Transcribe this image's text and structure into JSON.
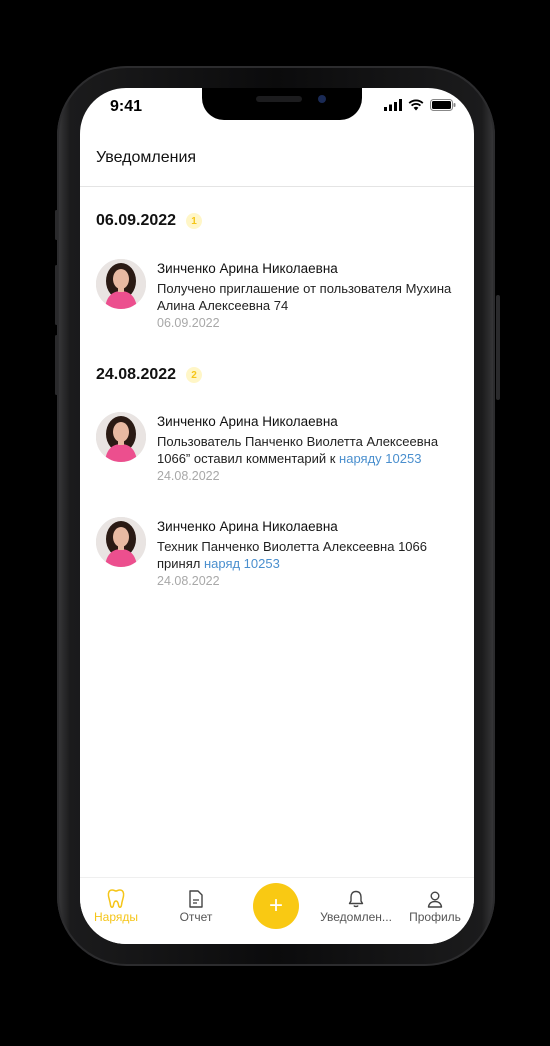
{
  "status_bar": {
    "time": "9:41"
  },
  "header": {
    "title": "Уведомления"
  },
  "groups": [
    {
      "date": "06.09.2022",
      "count": "1",
      "items": [
        {
          "name": "Зинченко Арина Николаевна",
          "text": "Получено приглашение от пользователя Мухина Алина Алексеевна 74",
          "link": "",
          "date": "06.09.2022"
        }
      ]
    },
    {
      "date": "24.08.2022",
      "count": "2",
      "items": [
        {
          "name": "Зинченко Арина Николаевна",
          "text": "Пользователь Панченко Виолетта Алексеевна 1066” оставил комментарий к ",
          "link": "наряду 10253",
          "date": "24.08.2022"
        },
        {
          "name": "Зинченко Арина Николаевна",
          "text": "Техник Панченко Виолетта Алексеевна 1066 принял ",
          "link": "наряд 10253",
          "date": "24.08.2022"
        }
      ]
    }
  ],
  "tabbar": {
    "tabs": [
      {
        "label": "Наряды",
        "icon": "tooth-icon",
        "active": true
      },
      {
        "label": "Отчет",
        "icon": "document-icon",
        "active": false
      },
      {
        "label": "+",
        "icon": "plus-icon",
        "active": false
      },
      {
        "label": "Уведомлен...",
        "icon": "bell-icon",
        "active": false
      },
      {
        "label": "Профиль",
        "icon": "user-icon",
        "active": false
      }
    ]
  },
  "colors": {
    "accent": "#f9c913",
    "link": "#4a8fce",
    "muted": "#a8a8a8"
  }
}
